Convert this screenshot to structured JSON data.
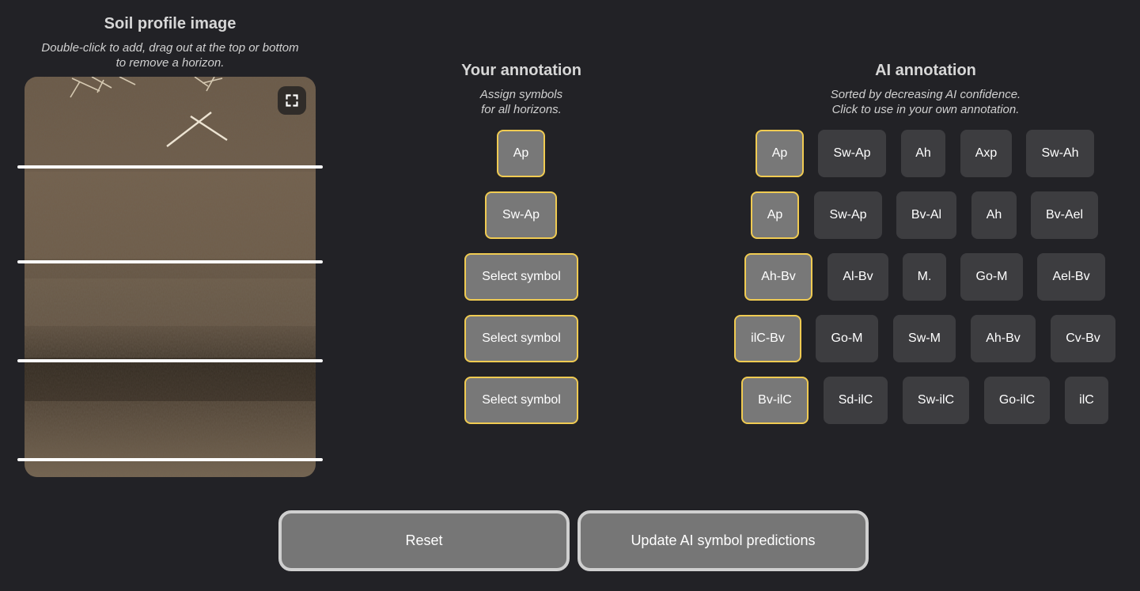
{
  "image_panel": {
    "title": "Soil profile image",
    "subtitle_line1": "Double-click to add, drag out at the top or bottom",
    "subtitle_line2": "to remove a horizon."
  },
  "user_panel": {
    "title": "Your annotation",
    "subtitle_line1": "Assign symbols",
    "subtitle_line2": "for all horizons.",
    "horizons": [
      "Ap",
      "Sw-Ap",
      "Select symbol",
      "Select symbol",
      "Select symbol"
    ]
  },
  "ai_panel": {
    "title": "AI annotation",
    "subtitle_line1": "Sorted by decreasing AI confidence.",
    "subtitle_line2": "Click to use in your own annotation.",
    "rows": [
      [
        "Ap",
        "Sw-Ap",
        "Ah",
        "Axp",
        "Sw-Ah"
      ],
      [
        "Ap",
        "Sw-Ap",
        "Bv-Al",
        "Ah",
        "Bv-Ael"
      ],
      [
        "Ah-Bv",
        "Al-Bv",
        "M.",
        "Go-M",
        "Ael-Bv"
      ],
      [
        "ilC-Bv",
        "Go-M",
        "Sw-M",
        "Ah-Bv",
        "Cv-Bv"
      ],
      [
        "Bv-ilC",
        "Sd-ilC",
        "Sw-ilC",
        "Go-ilC",
        "ilC"
      ]
    ]
  },
  "actions": {
    "reset_label": "Reset",
    "update_label": "Update AI symbol predictions"
  },
  "colors": {
    "background": "#222226",
    "selected_border": "#f0cb52",
    "selected_fill": "#787878",
    "option_fill": "#3d3d40"
  }
}
